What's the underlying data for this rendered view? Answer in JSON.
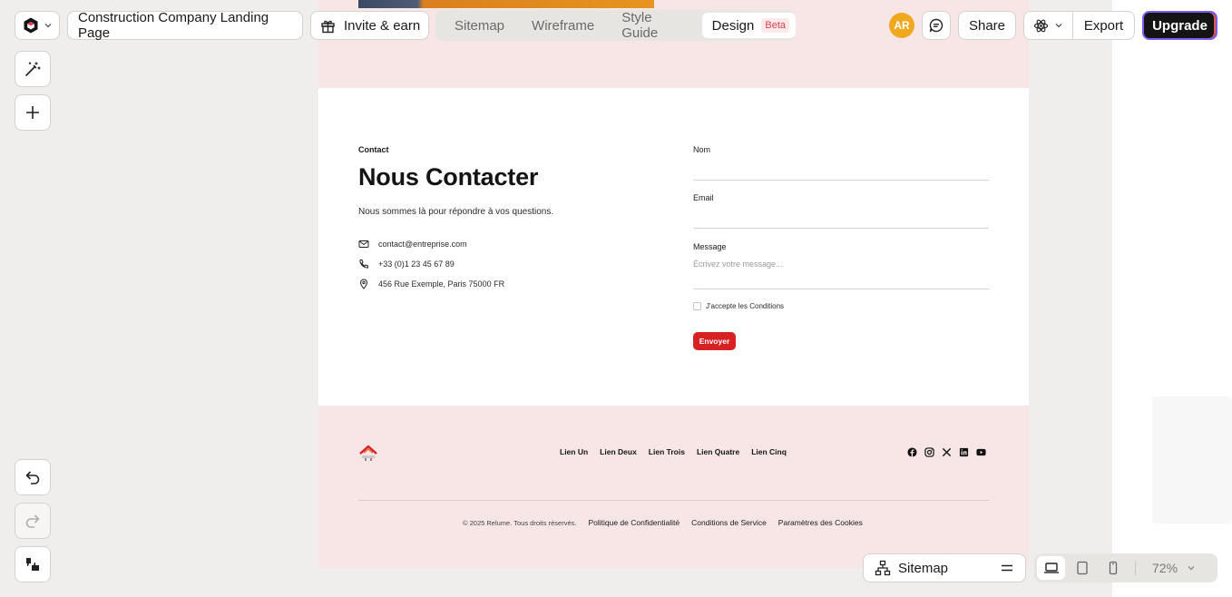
{
  "topbar": {
    "project_title": "Construction Company Landing Page",
    "invite_label": "Invite & earn",
    "tabs": [
      {
        "label": "Sitemap"
      },
      {
        "label": "Wireframe"
      },
      {
        "label": "Style Guide"
      },
      {
        "label": "Design",
        "badge": "Beta"
      }
    ],
    "avatar_initials": "AR",
    "share_label": "Share",
    "export_label": "Export",
    "upgrade_label": "Upgrade"
  },
  "contact": {
    "tag": "Contact",
    "title": "Nous Contacter",
    "description": "Nous sommes là pour répondre à vos questions.",
    "email": "contact@entreprise.com",
    "phone": "+33 (0)1 23 45 67 89",
    "address": "456 Rue Exemple, Paris 75000 FR"
  },
  "form": {
    "name_label": "Nom",
    "email_label": "Email",
    "message_label": "Message",
    "message_placeholder": "Écrivez votre message...",
    "accept_label": "J'accepte les Conditions",
    "submit_label": "Envoyer"
  },
  "footer": {
    "links": [
      "Lien Un",
      "Lien Deux",
      "Lien Trois",
      "Lien Quatre",
      "Lien Cinq"
    ],
    "copyright": "© 2025 Relume. Tous droits réservés.",
    "legal": [
      "Politique de Confidentialité",
      "Conditions de Service",
      "Paramètres des Cookies"
    ],
    "socials": [
      "facebook-icon",
      "instagram-icon",
      "x-icon",
      "linkedin-icon",
      "youtube-icon"
    ]
  },
  "bottom": {
    "sitemap_label": "Sitemap",
    "zoom": "72%"
  },
  "colors": {
    "accent_red": "#d72123",
    "band_pink": "#f8e6e6",
    "upgrade_bg": "#141414",
    "avatar_bg": "#f0a81e"
  }
}
